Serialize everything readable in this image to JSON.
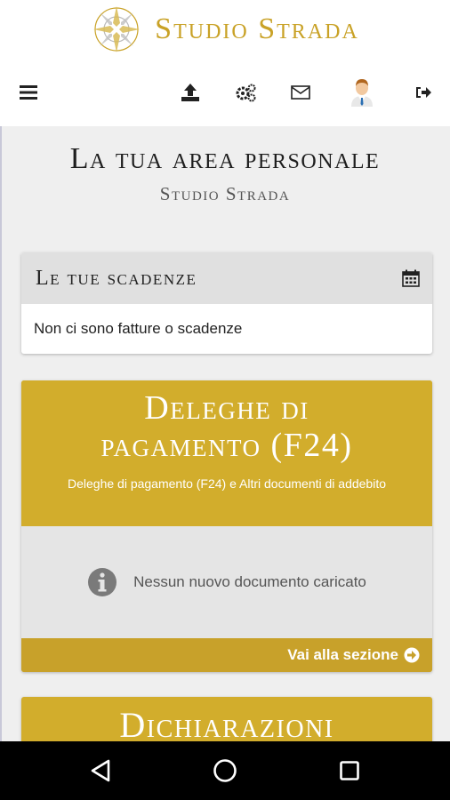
{
  "brand": {
    "name": "Studio Strada"
  },
  "nav": {
    "icons": [
      "menu-icon",
      "upload-icon",
      "settings-icon",
      "mail-icon",
      "avatar",
      "logout-icon"
    ]
  },
  "page": {
    "title": "La tua area personale",
    "subtitle": "Studio Strada"
  },
  "deadlines": {
    "title": "Le tue scadenze",
    "icon": "calendar-icon",
    "empty_message": "Non ci sono fatture o scadenze"
  },
  "f24": {
    "title_line1": "Deleghe di",
    "title_line2": "pagamento (F24)",
    "subtitle": "Deleghe di pagamento (F24) e Altri documenti di addebito",
    "empty_message": "Nessun nuovo documento caricato",
    "link_label": "Vai alla sezione"
  },
  "declarations": {
    "title": "Dichiarazioni"
  },
  "colors": {
    "gold": "#d2ad2c",
    "gold_dark": "#c8a12a",
    "background": "#efefef"
  }
}
